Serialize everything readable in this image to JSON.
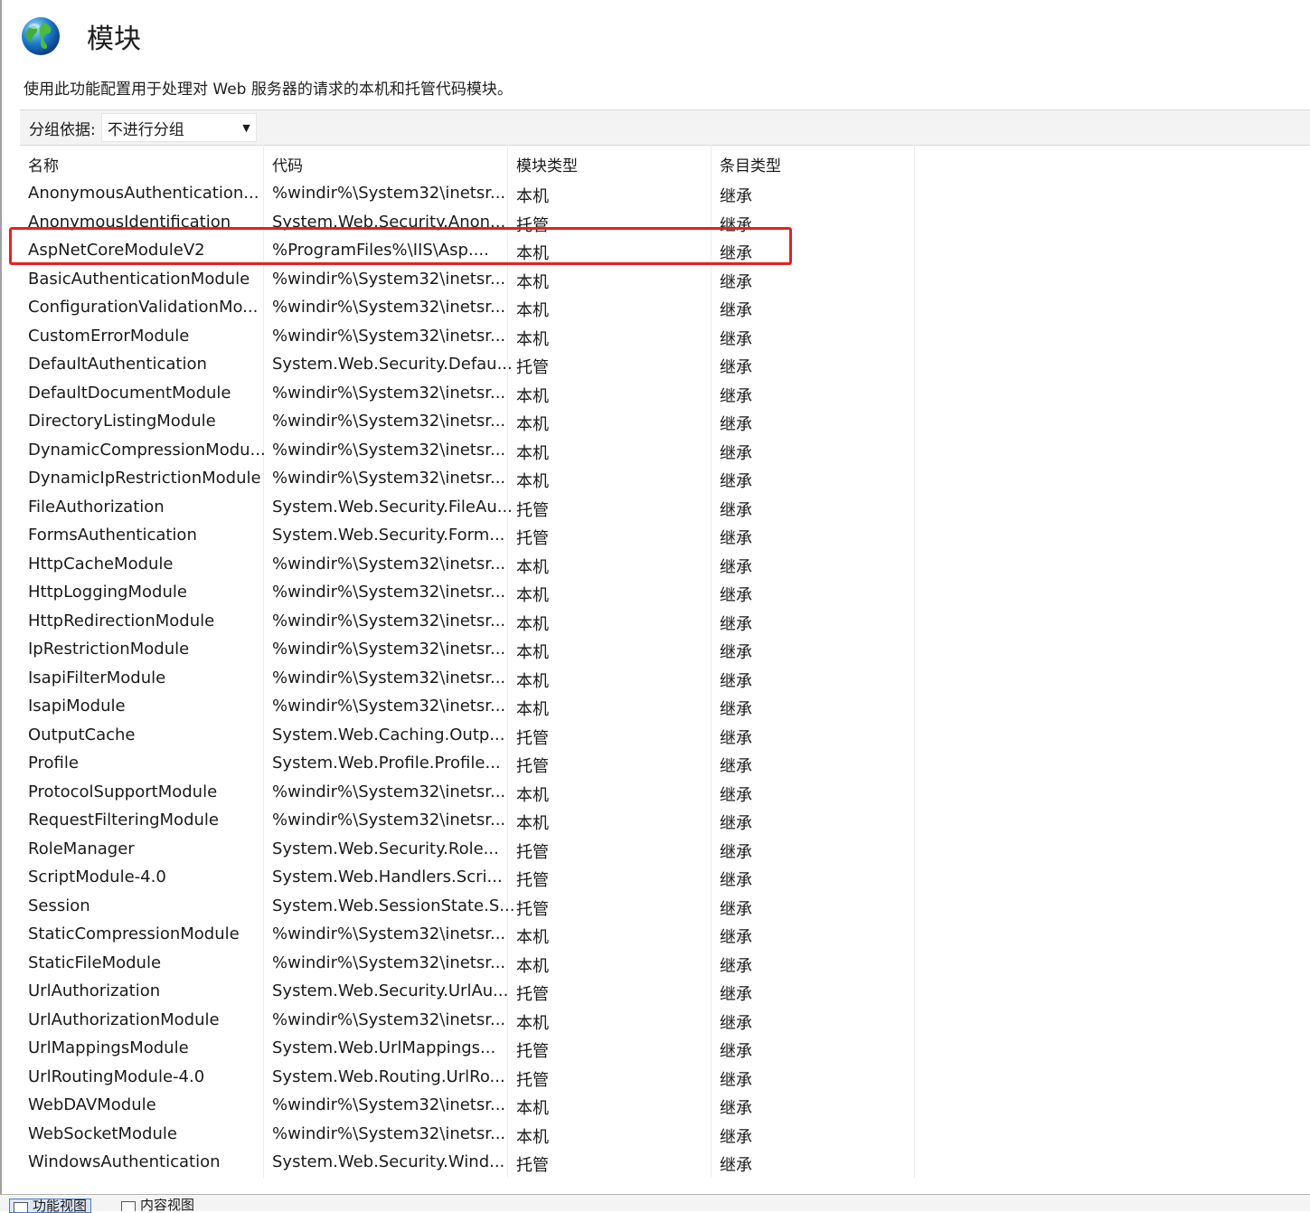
{
  "page": {
    "title": "模块",
    "description": "使用此功能配置用于处理对 Web 服务器的请求的本机和托管代码模块。"
  },
  "toolbar": {
    "group_label": "分组依据:",
    "group_value": "不进行分组"
  },
  "table": {
    "headers": [
      "名称",
      "代码",
      "模块类型",
      "条目类型"
    ],
    "rows": [
      [
        "AnonymousAuthentication...",
        "%windir%\\System32\\inetsr...",
        "本机",
        "继承"
      ],
      [
        "AnonymousIdentification",
        "System.Web.Security.Anon...",
        "托管",
        "继承"
      ],
      [
        "AspNetCoreModuleV2",
        "%ProgramFiles%\\IIS\\Asp....",
        "本机",
        "继承"
      ],
      [
        "BasicAuthenticationModule",
        "%windir%\\System32\\inetsr...",
        "本机",
        "继承"
      ],
      [
        "ConfigurationValidationMo...",
        "%windir%\\System32\\inetsr...",
        "本机",
        "继承"
      ],
      [
        "CustomErrorModule",
        "%windir%\\System32\\inetsr...",
        "本机",
        "继承"
      ],
      [
        "DefaultAuthentication",
        "System.Web.Security.Defau...",
        "托管",
        "继承"
      ],
      [
        "DefaultDocumentModule",
        "%windir%\\System32\\inetsr...",
        "本机",
        "继承"
      ],
      [
        "DirectoryListingModule",
        "%windir%\\System32\\inetsr...",
        "本机",
        "继承"
      ],
      [
        "DynamicCompressionModu...",
        "%windir%\\System32\\inetsr...",
        "本机",
        "继承"
      ],
      [
        "DynamicIpRestrictionModule",
        "%windir%\\System32\\inetsr...",
        "本机",
        "继承"
      ],
      [
        "FileAuthorization",
        "System.Web.Security.FileAu...",
        "托管",
        "继承"
      ],
      [
        "FormsAuthentication",
        "System.Web.Security.Form...",
        "托管",
        "继承"
      ],
      [
        "HttpCacheModule",
        "%windir%\\System32\\inetsr...",
        "本机",
        "继承"
      ],
      [
        "HttpLoggingModule",
        "%windir%\\System32\\inetsr...",
        "本机",
        "继承"
      ],
      [
        "HttpRedirectionModule",
        "%windir%\\System32\\inetsr...",
        "本机",
        "继承"
      ],
      [
        "IpRestrictionModule",
        "%windir%\\System32\\inetsr...",
        "本机",
        "继承"
      ],
      [
        "IsapiFilterModule",
        "%windir%\\System32\\inetsr...",
        "本机",
        "继承"
      ],
      [
        "IsapiModule",
        "%windir%\\System32\\inetsr...",
        "本机",
        "继承"
      ],
      [
        "OutputCache",
        "System.Web.Caching.Outp...",
        "托管",
        "继承"
      ],
      [
        "Profile",
        "System.Web.Profile.Profile...",
        "托管",
        "继承"
      ],
      [
        "ProtocolSupportModule",
        "%windir%\\System32\\inetsr...",
        "本机",
        "继承"
      ],
      [
        "RequestFilteringModule",
        "%windir%\\System32\\inetsr...",
        "本机",
        "继承"
      ],
      [
        "RoleManager",
        "System.Web.Security.Role...",
        "托管",
        "继承"
      ],
      [
        "ScriptModule-4.0",
        "System.Web.Handlers.Scri...",
        "托管",
        "继承"
      ],
      [
        "Session",
        "System.Web.SessionState.S...",
        "托管",
        "继承"
      ],
      [
        "StaticCompressionModule",
        "%windir%\\System32\\inetsr...",
        "本机",
        "继承"
      ],
      [
        "StaticFileModule",
        "%windir%\\System32\\inetsr...",
        "本机",
        "继承"
      ],
      [
        "UrlAuthorization",
        "System.Web.Security.UrlAu...",
        "托管",
        "继承"
      ],
      [
        "UrlAuthorizationModule",
        "%windir%\\System32\\inetsr...",
        "本机",
        "继承"
      ],
      [
        "UrlMappingsModule",
        "System.Web.UrlMappings...",
        "托管",
        "继承"
      ],
      [
        "UrlRoutingModule-4.0",
        "System.Web.Routing.UrlRo...",
        "托管",
        "继承"
      ],
      [
        "WebDAVModule",
        "%windir%\\System32\\inetsr...",
        "本机",
        "继承"
      ],
      [
        "WebSocketModule",
        "%windir%\\System32\\inetsr...",
        "本机",
        "继承"
      ],
      [
        "WindowsAuthentication",
        "System.Web.Security.Wind...",
        "托管",
        "继承"
      ]
    ]
  },
  "statusbar": {
    "features_view": "功能视图",
    "content_view": "内容视图"
  },
  "icons": {
    "title_icon": "globe-icon",
    "dropdown": "dropdown-arrow-icon",
    "sort": "sort-ascending-icon"
  },
  "colors": {
    "highlight_border": "#e8201f",
    "toolbar_bg": "#f3f3f3"
  }
}
